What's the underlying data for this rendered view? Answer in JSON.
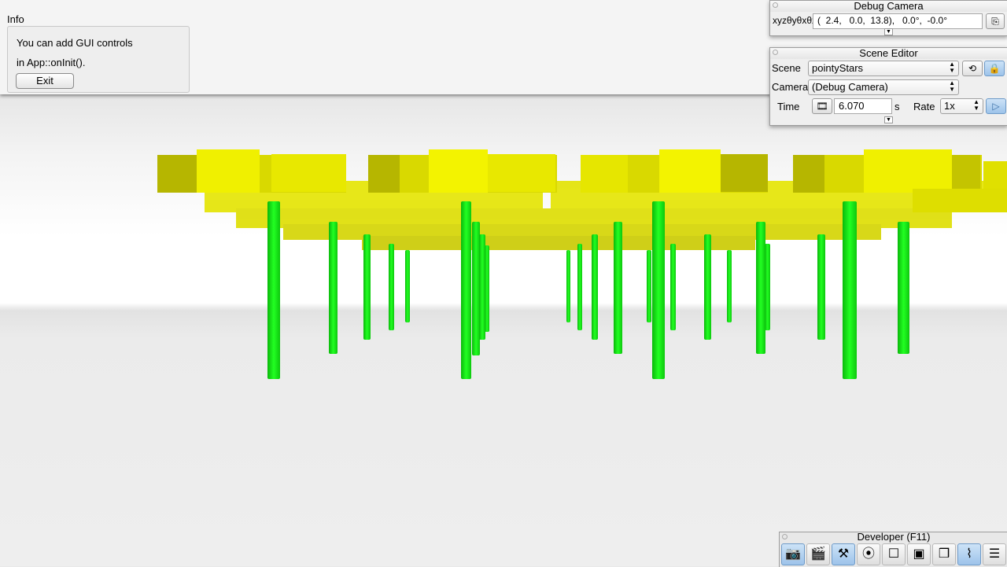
{
  "info_panel": {
    "title": "Info",
    "line1": "You can add GUI controls",
    "line2": "in App::onInit().",
    "exit_label": "Exit"
  },
  "debug_camera": {
    "title": "Debug Camera",
    "coord_label": "xyzθyθxθz",
    "coord_value": "(  2.4,   0.0,  13.8),   0.0°,  -0.0°",
    "copy_icon": "copy-icon"
  },
  "scene_editor": {
    "title": "Scene Editor",
    "scene_label": "Scene",
    "scene_value": "pointyStars",
    "camera_label": "Camera",
    "camera_value": "(Debug Camera)",
    "time_label": "Time",
    "time_value": "6.070",
    "time_unit": "s",
    "rate_label": "Rate",
    "rate_value": "1x",
    "icons": [
      "reload-icon",
      "lock-icon",
      "film-icon",
      "play-icon"
    ]
  },
  "developer": {
    "title": "Developer (F11)",
    "tools": [
      {
        "icon": "camera-icon",
        "glyph": "📷"
      },
      {
        "icon": "clapperboard-icon",
        "glyph": "🎬"
      },
      {
        "icon": "tools-icon",
        "glyph": "⚒"
      },
      {
        "icon": "compass-icon",
        "glyph": "⦿"
      },
      {
        "icon": "light-icon",
        "glyph": "☐"
      },
      {
        "icon": "terminal-icon",
        "glyph": "▣"
      },
      {
        "icon": "scene-icon",
        "glyph": "❒"
      },
      {
        "icon": "profiler-icon",
        "glyph": "⌇"
      },
      {
        "icon": "document-icon",
        "glyph": "☰"
      }
    ]
  },
  "colors": {
    "yellow": "#e6e600",
    "green": "#16e516",
    "accent": "#9dc3ea"
  }
}
